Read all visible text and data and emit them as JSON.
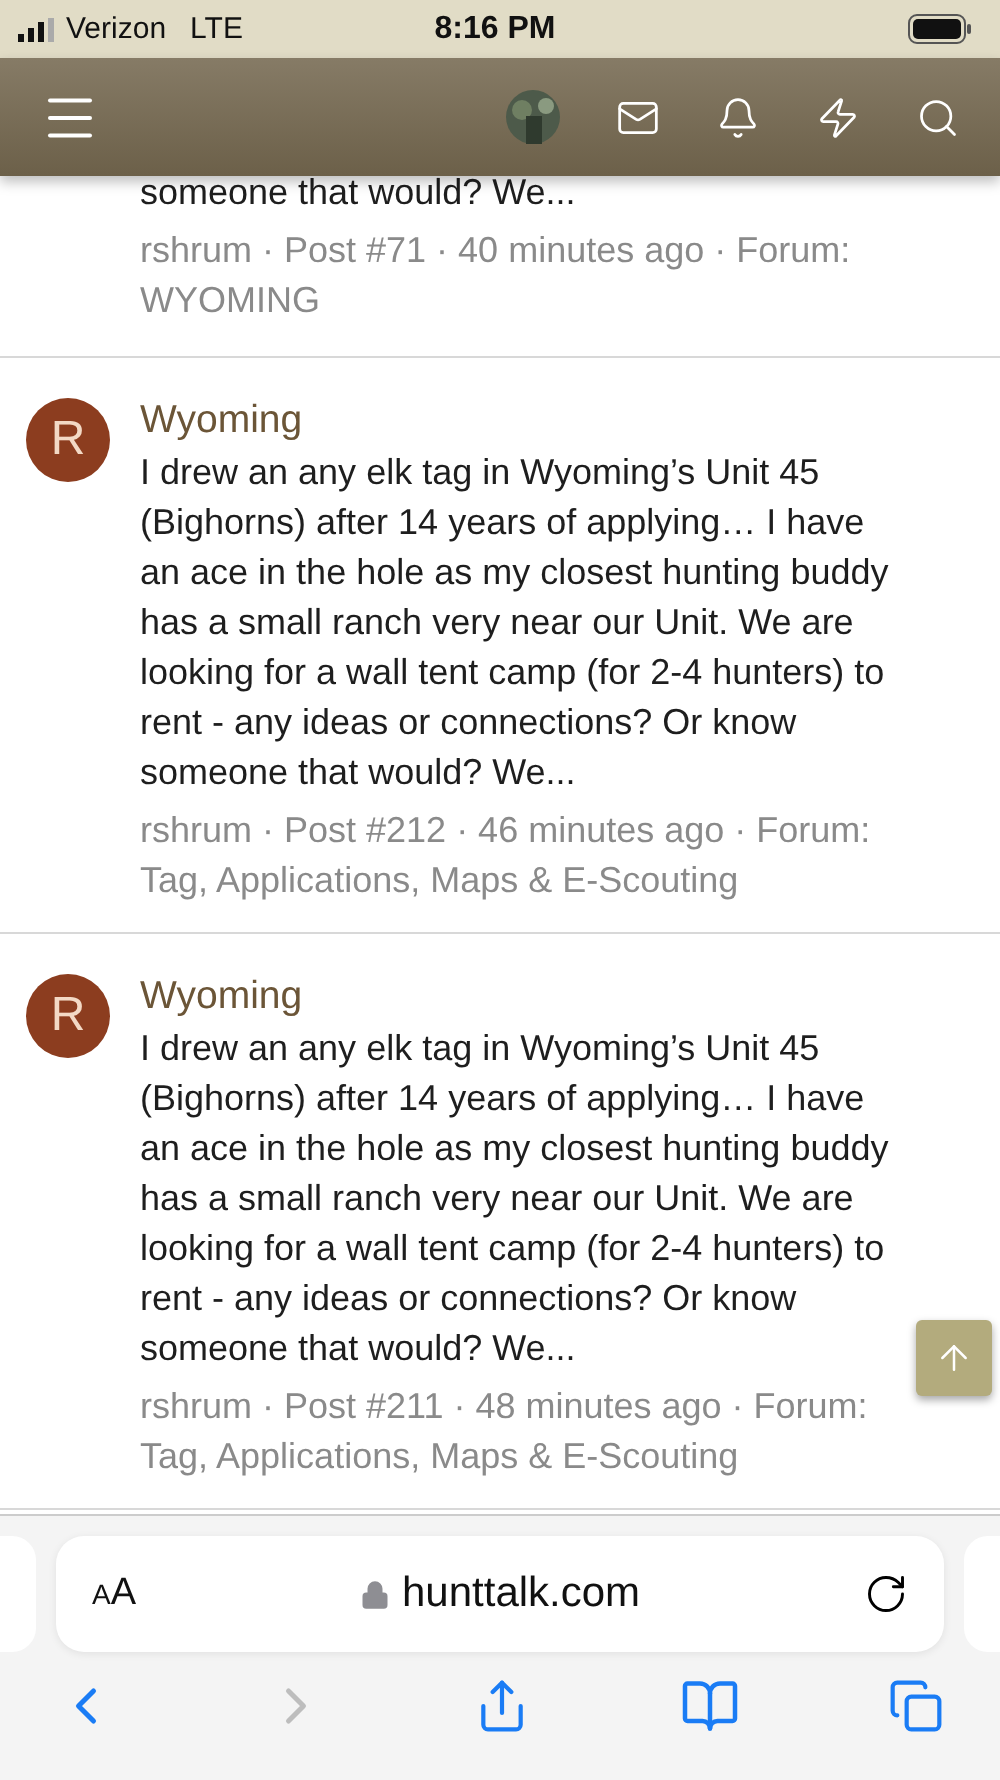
{
  "status_bar": {
    "carrier": "Verizon",
    "network": "LTE",
    "time": "8:16 PM"
  },
  "posts": [
    {
      "kind": "partial",
      "body": "someone that would? We...",
      "meta": "rshrum · Post #71 · 40 minutes ago · Forum: WYOMING"
    },
    {
      "kind": "full",
      "avatar_letter": "R",
      "title": "Wyoming",
      "body": "I drew an any elk tag in Wyoming’s Unit 45 (Bighorns) after 14 years of applying… I have an ace in the hole as my closest hunting buddy has a small ranch very near our Unit. We are looking for a wall tent camp (for 2-4 hunters) to rent - any ideas or connections? Or know someone that would? We...",
      "meta": "rshrum · Post #212 · 46 minutes ago · Forum: Tag, Applications, Maps & E-Scouting"
    },
    {
      "kind": "full",
      "avatar_letter": "R",
      "title": "Wyoming",
      "body": "I drew an any elk tag in Wyoming’s Unit 45 (Bighorns) after 14 years of applying… I have an ace in the hole as my closest hunting buddy has a small ranch very near our Unit. We are looking for a wall tent camp (for 2-4 hunters) to rent - any ideas or connections? Or know someone that would? We...",
      "meta": "rshrum · Post #211 · 48 minutes ago · Forum: Tag, Applications, Maps & E-Scouting"
    }
  ],
  "browser": {
    "text_size": "AA",
    "url": "hunttalk.com",
    "back_disabled": false,
    "forward_disabled": true
  }
}
